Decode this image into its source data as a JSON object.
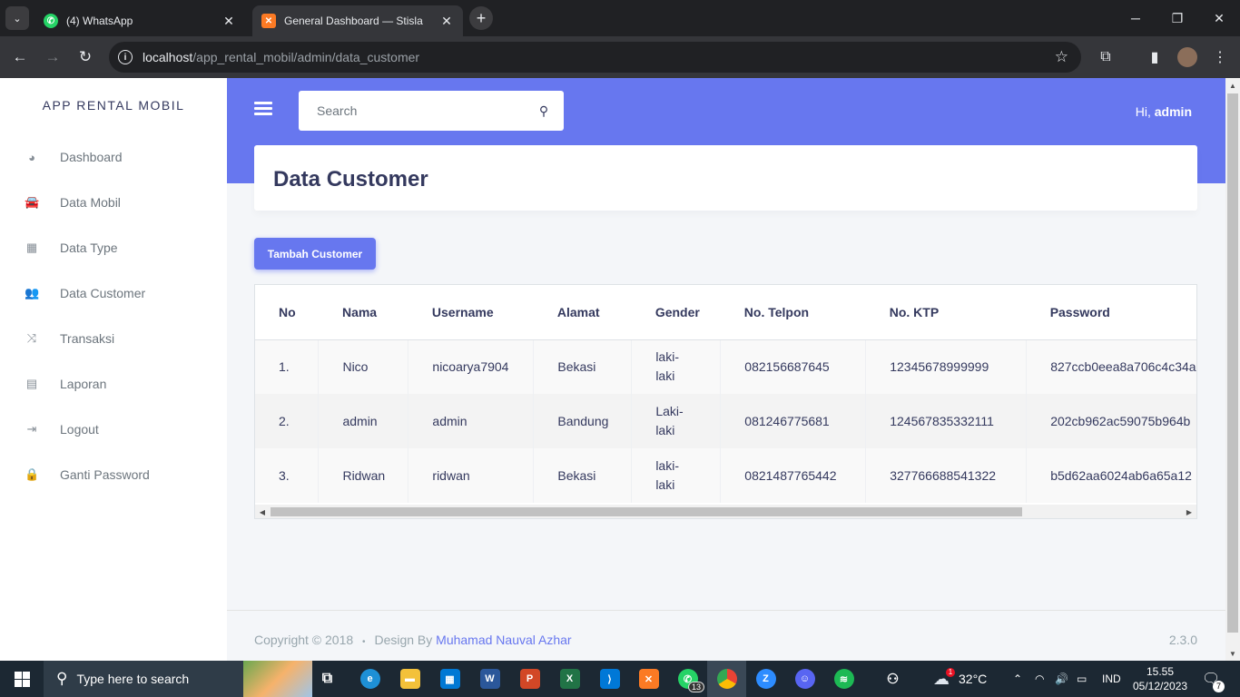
{
  "browser": {
    "tabs": [
      {
        "title": "(4) WhatsApp",
        "active": false
      },
      {
        "title": "General Dashboard — Stisla",
        "active": true
      }
    ],
    "url_host": "localhost",
    "url_path": "/app_rental_mobil/admin/data_customer"
  },
  "sidebar": {
    "brand": "APP RENTAL MOBIL",
    "items": [
      {
        "label": "Dashboard",
        "icon": "dashboard-icon"
      },
      {
        "label": "Data Mobil",
        "icon": "car-icon"
      },
      {
        "label": "Data Type",
        "icon": "grid-icon"
      },
      {
        "label": "Data Customer",
        "icon": "users-icon"
      },
      {
        "label": "Transaksi",
        "icon": "random-icon"
      },
      {
        "label": "Laporan",
        "icon": "clipboard-icon"
      },
      {
        "label": "Logout",
        "icon": "sign-out-icon"
      },
      {
        "label": "Ganti Password",
        "icon": "lock-icon"
      }
    ]
  },
  "header": {
    "search_placeholder": "Search",
    "greeting": "Hi,",
    "user": "admin"
  },
  "main": {
    "title": "Data Customer",
    "add_button": "Tambah Customer",
    "table": {
      "columns": [
        "No",
        "Nama",
        "Username",
        "Alamat",
        "Gender",
        "No. Telpon",
        "No. KTP",
        "Password"
      ],
      "rows": [
        [
          "1.",
          "Nico",
          "nicoarya7904",
          "Bekasi",
          "laki-laki",
          "082156687645",
          "12345678999999",
          "827ccb0eea8a706c4c34a"
        ],
        [
          "2.",
          "admin",
          "admin",
          "Bandung",
          "Laki-laki",
          "081246775681",
          "124567835332111",
          "202cb962ac59075b964b"
        ],
        [
          "3.",
          "Ridwan",
          "ridwan",
          "Bekasi",
          "laki-laki",
          "0821487765442",
          "327766688541322",
          "b5d62aa6024ab6a65a12"
        ]
      ]
    }
  },
  "footer": {
    "copyright": "Copyright © 2018",
    "bullet": "•",
    "design_by": "Design By",
    "author": "Muhamad Nauval Azhar",
    "version": "2.3.0"
  },
  "taskbar": {
    "search_text": "Type here to search",
    "whatsapp_badge": "13",
    "weather": "32°C",
    "weather_badge": "1",
    "lang": "IND",
    "time": "15.55",
    "date": "05/12/2023",
    "notifications": "7"
  },
  "colors": {
    "primary": "#6777ef",
    "text_dark": "#34395e"
  }
}
